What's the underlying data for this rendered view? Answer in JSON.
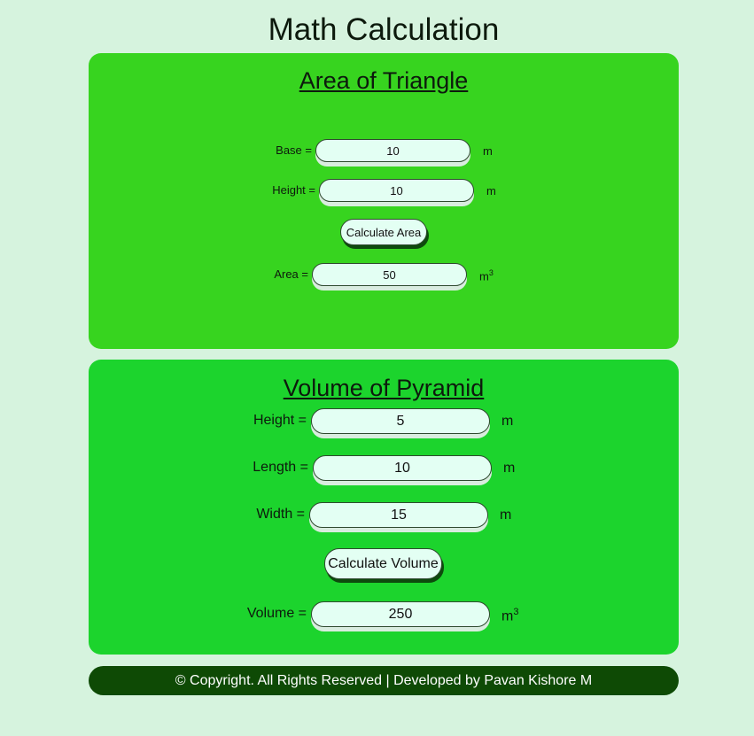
{
  "page": {
    "title": "Math Calculation"
  },
  "triangle": {
    "title": "Area of Triangle",
    "base": {
      "label": "Base =",
      "value": "10",
      "unit": "m"
    },
    "height": {
      "label": "Height =",
      "value": "10",
      "unit": "m"
    },
    "button": "Calculate Area",
    "area": {
      "label": "Area =",
      "value": "50",
      "unit": "m",
      "unit_sup": "3"
    }
  },
  "pyramid": {
    "title": "Volume of Pyramid",
    "height": {
      "label": "Height =",
      "value": "5",
      "unit": "m"
    },
    "length": {
      "label": "Length =",
      "value": "10",
      "unit": "m"
    },
    "width": {
      "label": "Width =",
      "value": "15",
      "unit": "m"
    },
    "button": "Calculate Volume",
    "volume": {
      "label": "Volume =",
      "value": "250",
      "unit": "m",
      "unit_sup": "3"
    }
  },
  "footer": {
    "text": "© Copyright. All Rights Reserved | Developed by Pavan Kishore M"
  },
  "colors": {
    "page_bg": "#d6f3de",
    "triangle_card": "#37d41f",
    "pyramid_card": "#1cd42d",
    "field_bg": "#e3fff3",
    "footer_bg": "#0e4a05"
  }
}
